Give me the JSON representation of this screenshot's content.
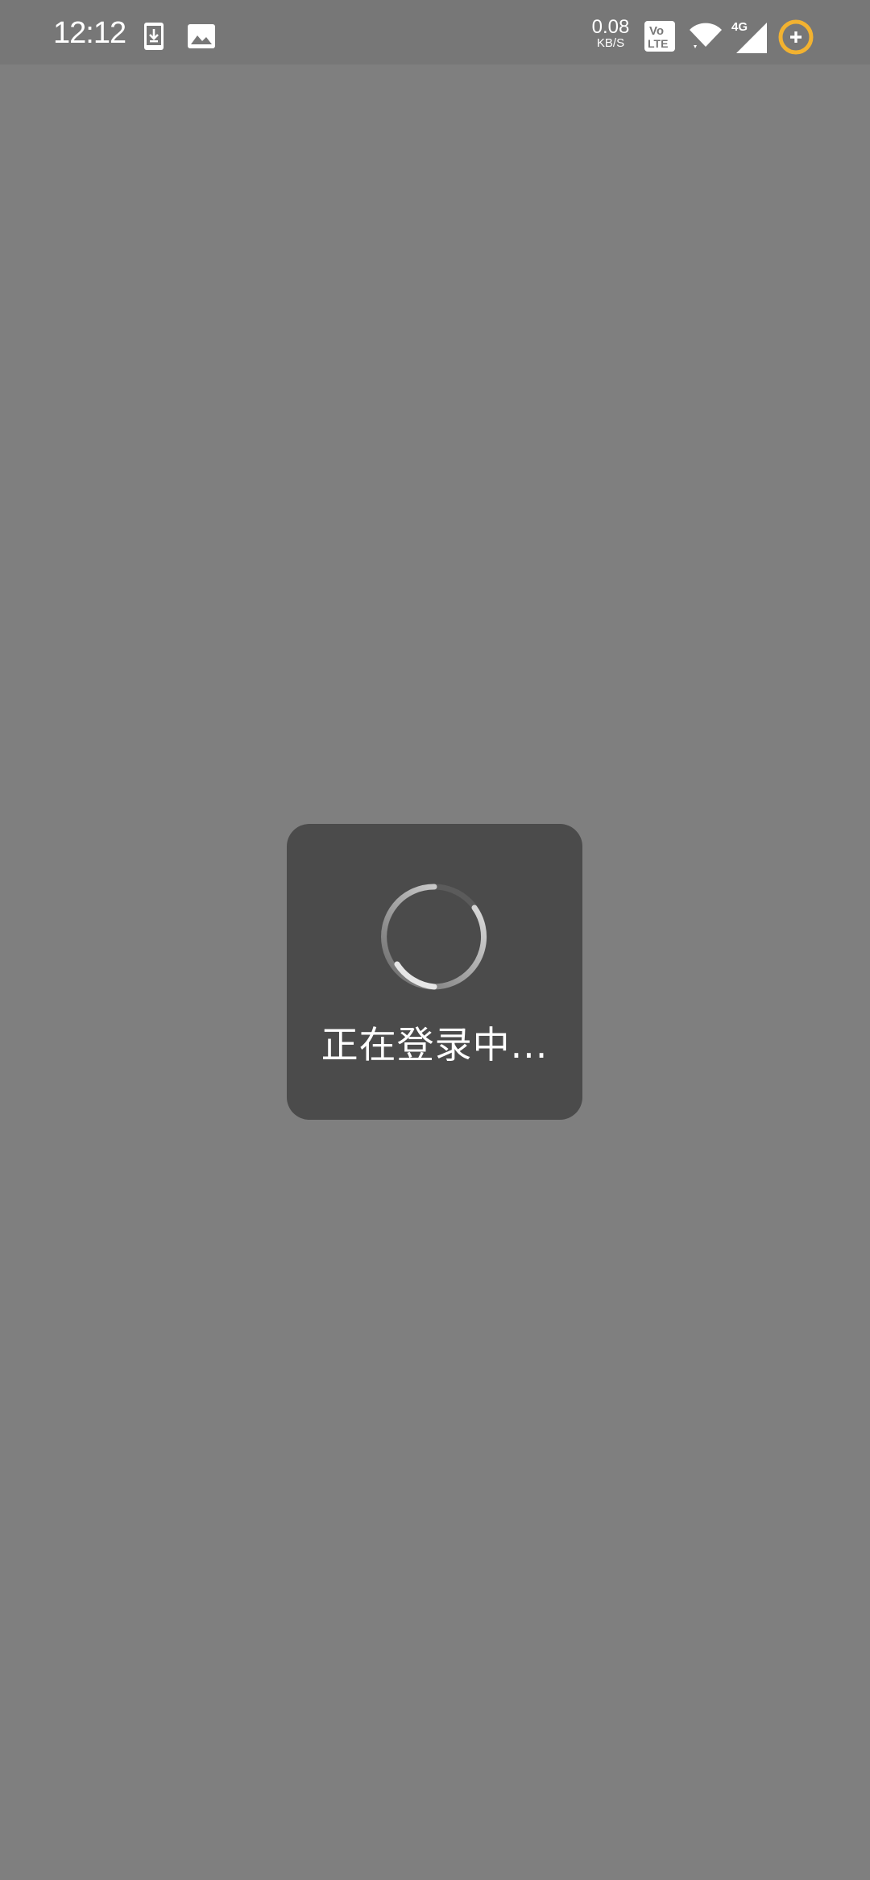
{
  "status_bar": {
    "time": "12:12",
    "net_speed_value": "0.08",
    "net_speed_unit": "KB/S",
    "volte_top": "Vo",
    "volte_bottom": "LTE",
    "network_type": "4G",
    "icons": [
      "download-icon",
      "image-icon",
      "volte-icon",
      "wifi-icon",
      "signal-icon",
      "add-icon"
    ],
    "accent_color": "#f2b230"
  },
  "dialog": {
    "message": "正在登录中..."
  }
}
